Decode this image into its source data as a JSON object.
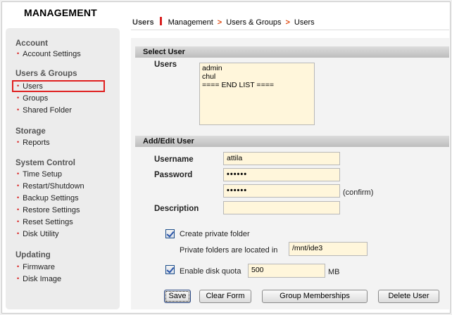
{
  "sidebar": {
    "title": "MANAGEMENT",
    "sections": [
      {
        "label": "Account",
        "items": [
          "Account Settings"
        ]
      },
      {
        "label": "Users & Groups",
        "items": [
          "Users",
          "Groups",
          "Shared Folder"
        ]
      },
      {
        "label": "Storage",
        "items": [
          "Reports"
        ]
      },
      {
        "label": "System Control",
        "items": [
          "Time Setup",
          "Restart/Shutdown",
          "Backup Settings",
          "Restore Settings",
          "Reset Settings",
          "Disk Utility"
        ]
      },
      {
        "label": "Updating",
        "items": [
          "Firmware",
          "Disk Image"
        ]
      }
    ]
  },
  "breadcrumb": {
    "current": "Users",
    "path": [
      "Management",
      "Users & Groups",
      "Users"
    ]
  },
  "select_user": {
    "header": "Select User",
    "users_label": "Users",
    "users": [
      "admin",
      "chul",
      "==== END LIST ===="
    ]
  },
  "add_edit": {
    "header": "Add/Edit User",
    "username_label": "Username",
    "username_value": "attila",
    "password_label": "Password",
    "password_value": "••••••",
    "confirm_value": "••••••",
    "confirm_suffix": "(confirm)",
    "description_label": "Description",
    "description_value": "",
    "private_folder_label": "Create private folder",
    "private_folder_checked": true,
    "private_location_label": "Private folders are located in",
    "private_location_value": "/mnt/ide3",
    "quota_label": "Enable disk quota",
    "quota_checked": true,
    "quota_value": "500",
    "quota_unit": "MB"
  },
  "buttons": {
    "save": "Save",
    "clear": "Clear Form",
    "groups": "Group Memberships",
    "delete": "Delete User"
  }
}
